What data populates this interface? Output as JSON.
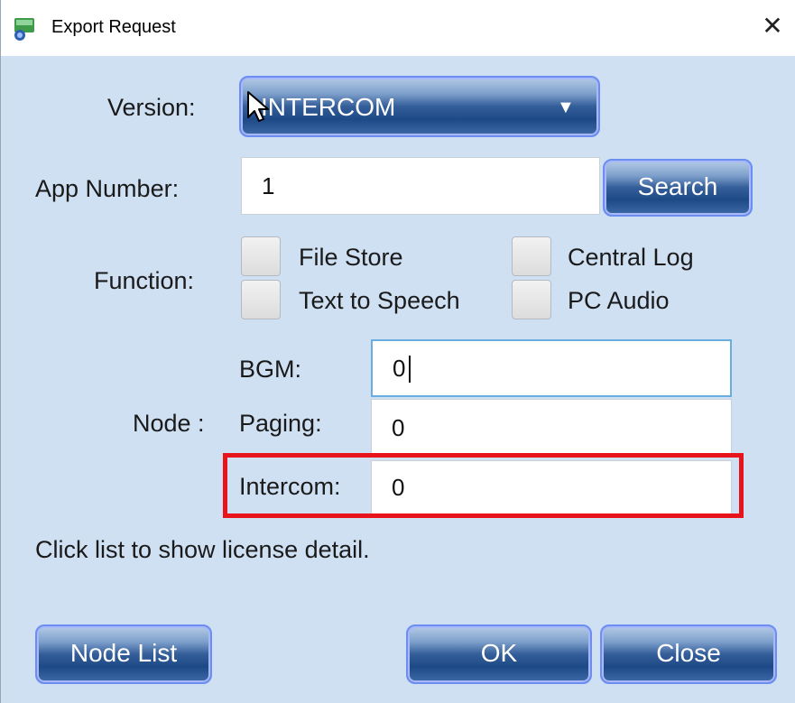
{
  "window": {
    "title": "Export Request",
    "close_glyph": "✕",
    "app_icon": "app-icon"
  },
  "version": {
    "label": "Version:",
    "selected": "INTERCOM",
    "arrow_glyph": "▼"
  },
  "app_number": {
    "label": "App Number:",
    "value": "1",
    "search_label": "Search"
  },
  "function": {
    "label": "Function:",
    "options": [
      {
        "label": "File Store",
        "checked": false
      },
      {
        "label": "Central Log",
        "checked": false
      },
      {
        "label": "Text to Speech",
        "checked": false
      },
      {
        "label": "PC Audio",
        "checked": false
      }
    ]
  },
  "node": {
    "label": "Node :",
    "bgm": {
      "label": "BGM:",
      "value": "0"
    },
    "paging": {
      "label": "Paging:",
      "value": "0"
    },
    "intercom": {
      "label": "Intercom:",
      "value": "0"
    }
  },
  "hint": "Click list to show license detail.",
  "buttons": {
    "node_list": "Node List",
    "ok": "OK",
    "close": "Close"
  },
  "colors": {
    "background": "#cfe0f3",
    "highlight": "#e8141c",
    "button_top": "#b4cbe6",
    "button_bottom": "#1d4a86"
  }
}
